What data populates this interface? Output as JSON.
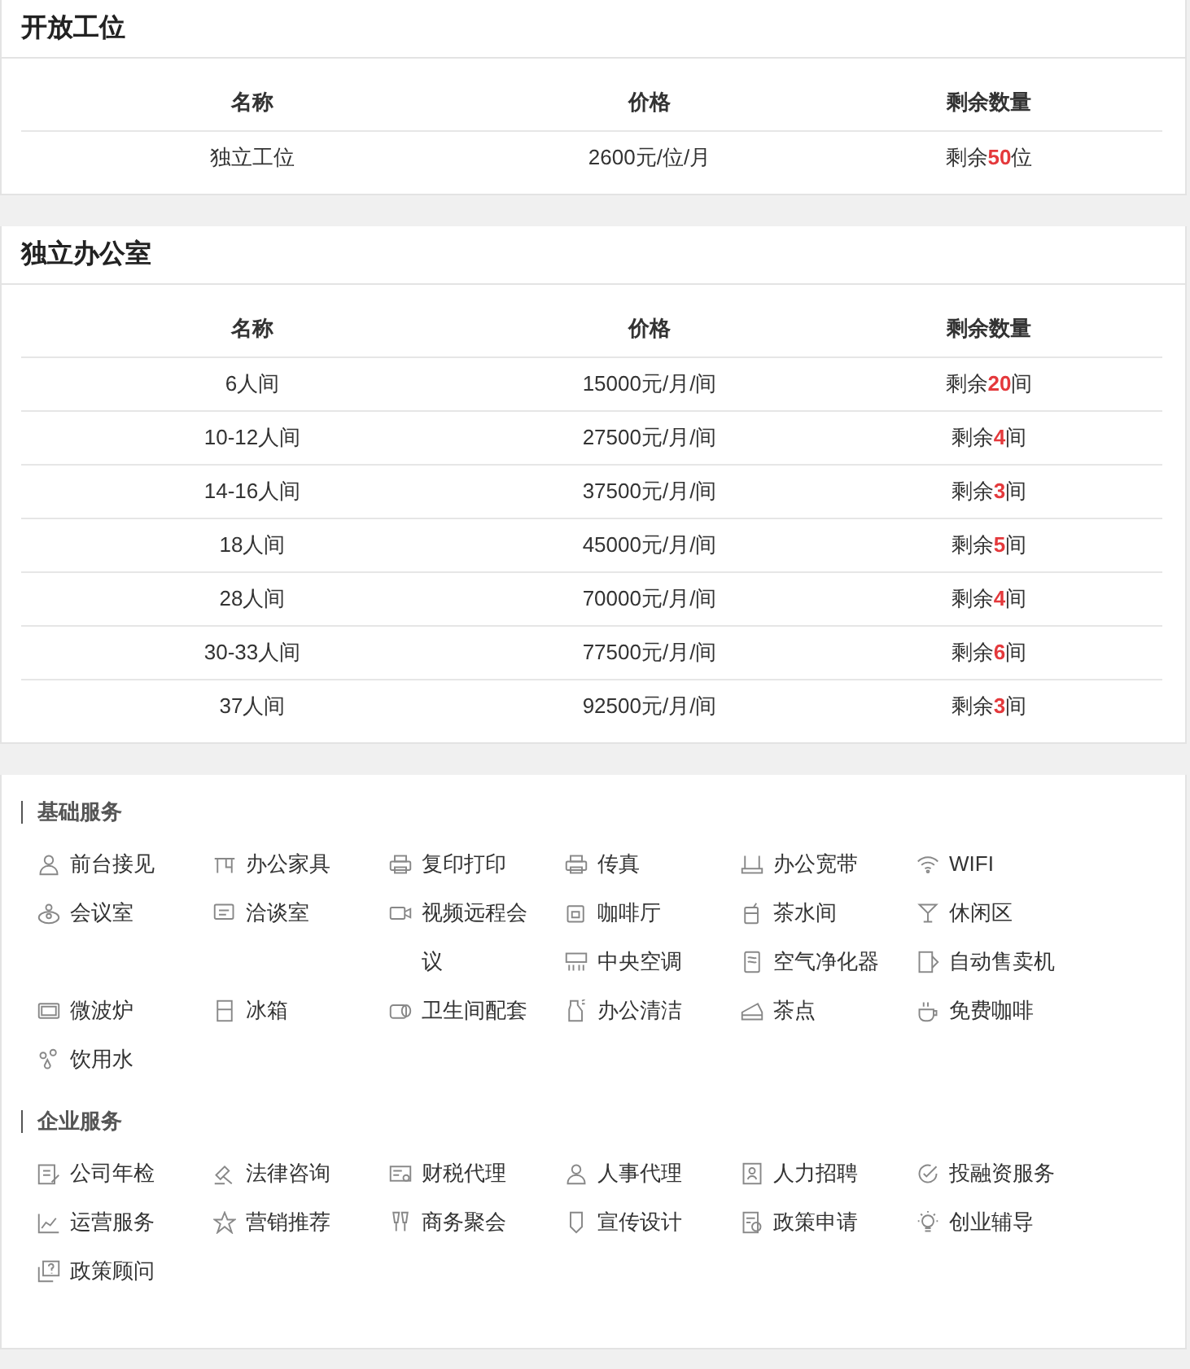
{
  "sections": [
    {
      "title": "开放工位",
      "columns": [
        "名称",
        "价格",
        "剩余数量"
      ],
      "rows": [
        {
          "name": "独立工位",
          "price": "2600元/位/月",
          "remaining": "剩余**50**位"
        }
      ]
    },
    {
      "title": "独立办公室",
      "columns": [
        "名称",
        "价格",
        "剩余数量"
      ],
      "rows": [
        {
          "name": "6人间",
          "price": "15000元/月/间",
          "remaining": "剩余**20**间"
        },
        {
          "name": "10-12人间",
          "price": "27500元/月/间",
          "remaining": "剩余**4**间"
        },
        {
          "name": "14-16人间",
          "price": "37500元/月/间",
          "remaining": "剩余**3**间"
        },
        {
          "name": "18人间",
          "price": "45000元/月/间",
          "remaining": "剩余**5**间"
        },
        {
          "name": "28人间",
          "price": "70000元/月/间",
          "remaining": "剩余**4**间"
        },
        {
          "name": "30-33人间",
          "price": "77500元/月/间",
          "remaining": "剩余**6**间"
        },
        {
          "name": "37人间",
          "price": "92500元/月/间",
          "remaining": "剩余**3**间"
        }
      ]
    }
  ],
  "services": [
    {
      "title": "基础服务",
      "items": [
        "前台接见",
        "办公家具",
        "复印打印",
        "传真",
        "办公宽带",
        "WIFI",
        "会议室",
        "洽谈室",
        "视频远程会议",
        "咖啡厅",
        "茶水间",
        "休闲区",
        "中央空调",
        "空气净化器",
        "自动售卖机",
        "微波炉",
        "冰箱",
        "卫生间配套",
        "办公清洁",
        "茶点",
        "免费咖啡",
        "饮用水"
      ]
    },
    {
      "title": "企业服务",
      "items": [
        "公司年检",
        "法律咨询",
        "财税代理",
        "人事代理",
        "人力招聘",
        "投融资服务",
        "运营服务",
        "营销推荐",
        "商务聚会",
        "宣传设计",
        "政策申请",
        "创业辅导",
        "政策顾问"
      ]
    }
  ]
}
